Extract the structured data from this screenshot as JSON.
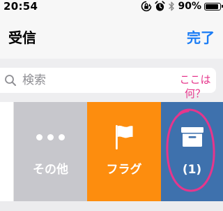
{
  "status_bar": {
    "time": "20:54",
    "battery_percent": "90%",
    "battery_level": 0.9,
    "icons": [
      "orientation-lock-icon",
      "alarm-icon",
      "bluetooth-icon",
      "battery-icon"
    ]
  },
  "nav": {
    "title": "受信",
    "done_label": "完了",
    "accent_color": "#1a7cf5"
  },
  "search": {
    "placeholder": "検索",
    "icon": "search-icon"
  },
  "annotation": {
    "line1": "ここは",
    "line2": "何？",
    "color": "#e6368c"
  },
  "swipe_actions": {
    "more": {
      "label": "その他",
      "icon": "more-dots-icon",
      "color": "#c7c7cc"
    },
    "flag": {
      "label": "フラグ",
      "icon": "flag-icon",
      "color": "#fd8d0e"
    },
    "archive": {
      "label": "(1)",
      "icon": "archive-box-icon",
      "color": "#3e71ad"
    }
  }
}
